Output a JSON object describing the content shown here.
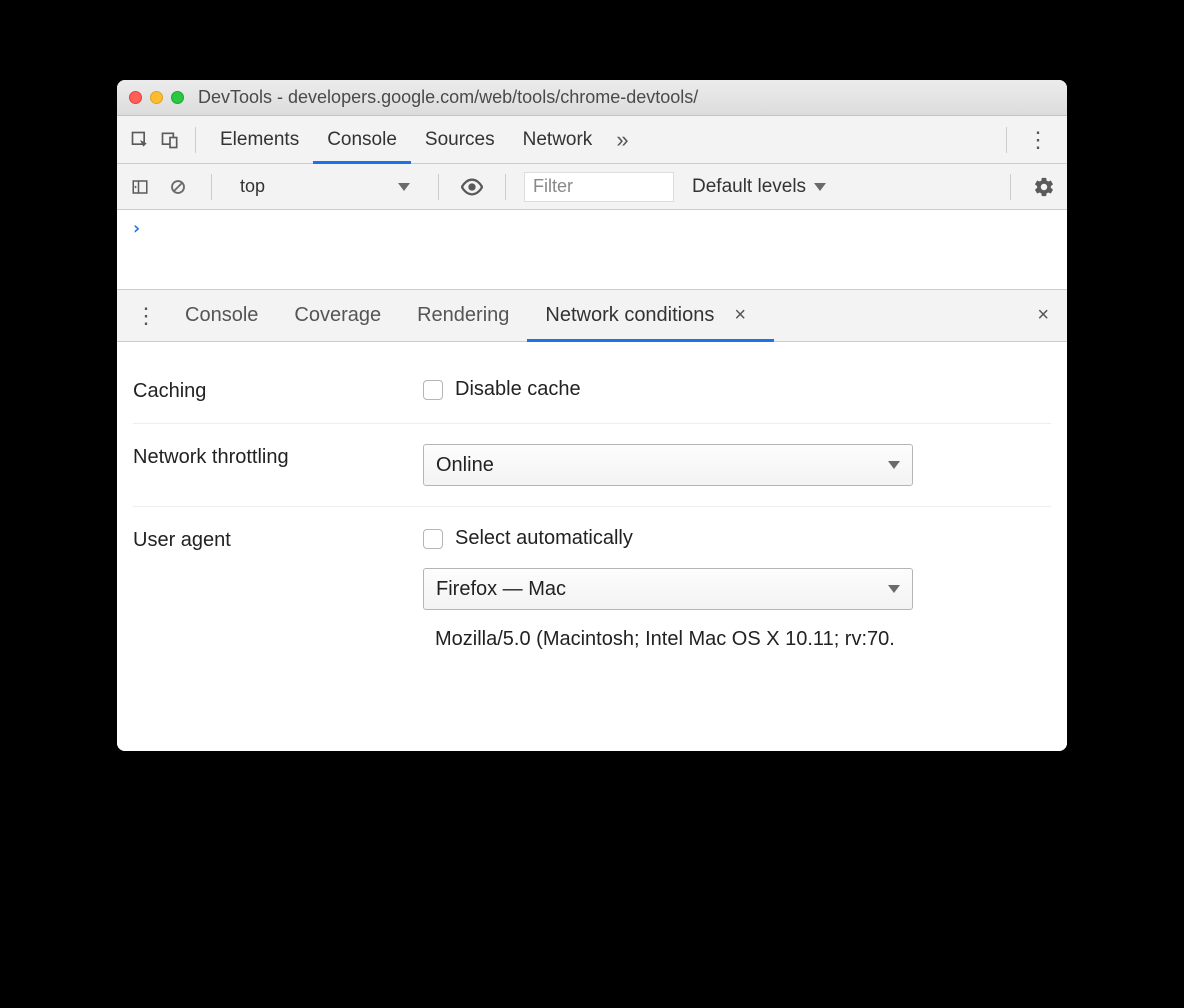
{
  "window": {
    "title": "DevTools - developers.google.com/web/tools/chrome-devtools/"
  },
  "tabs": {
    "items": [
      "Elements",
      "Console",
      "Sources",
      "Network"
    ],
    "active": "Console"
  },
  "consoleBar": {
    "context": "top",
    "filterPlaceholder": "Filter",
    "levels": "Default levels"
  },
  "drawer": {
    "tabs": [
      "Console",
      "Coverage",
      "Rendering",
      "Network conditions"
    ],
    "active": "Network conditions"
  },
  "netConditions": {
    "cachingLabel": "Caching",
    "disableCacheLabel": "Disable cache",
    "throttlingLabel": "Network throttling",
    "throttlingValue": "Online",
    "userAgentLabel": "User agent",
    "selectAutoLabel": "Select automatically",
    "userAgentValue": "Firefox — Mac",
    "userAgentString": "Mozilla/5.0 (Macintosh; Intel Mac OS X 10.11; rv:70."
  }
}
